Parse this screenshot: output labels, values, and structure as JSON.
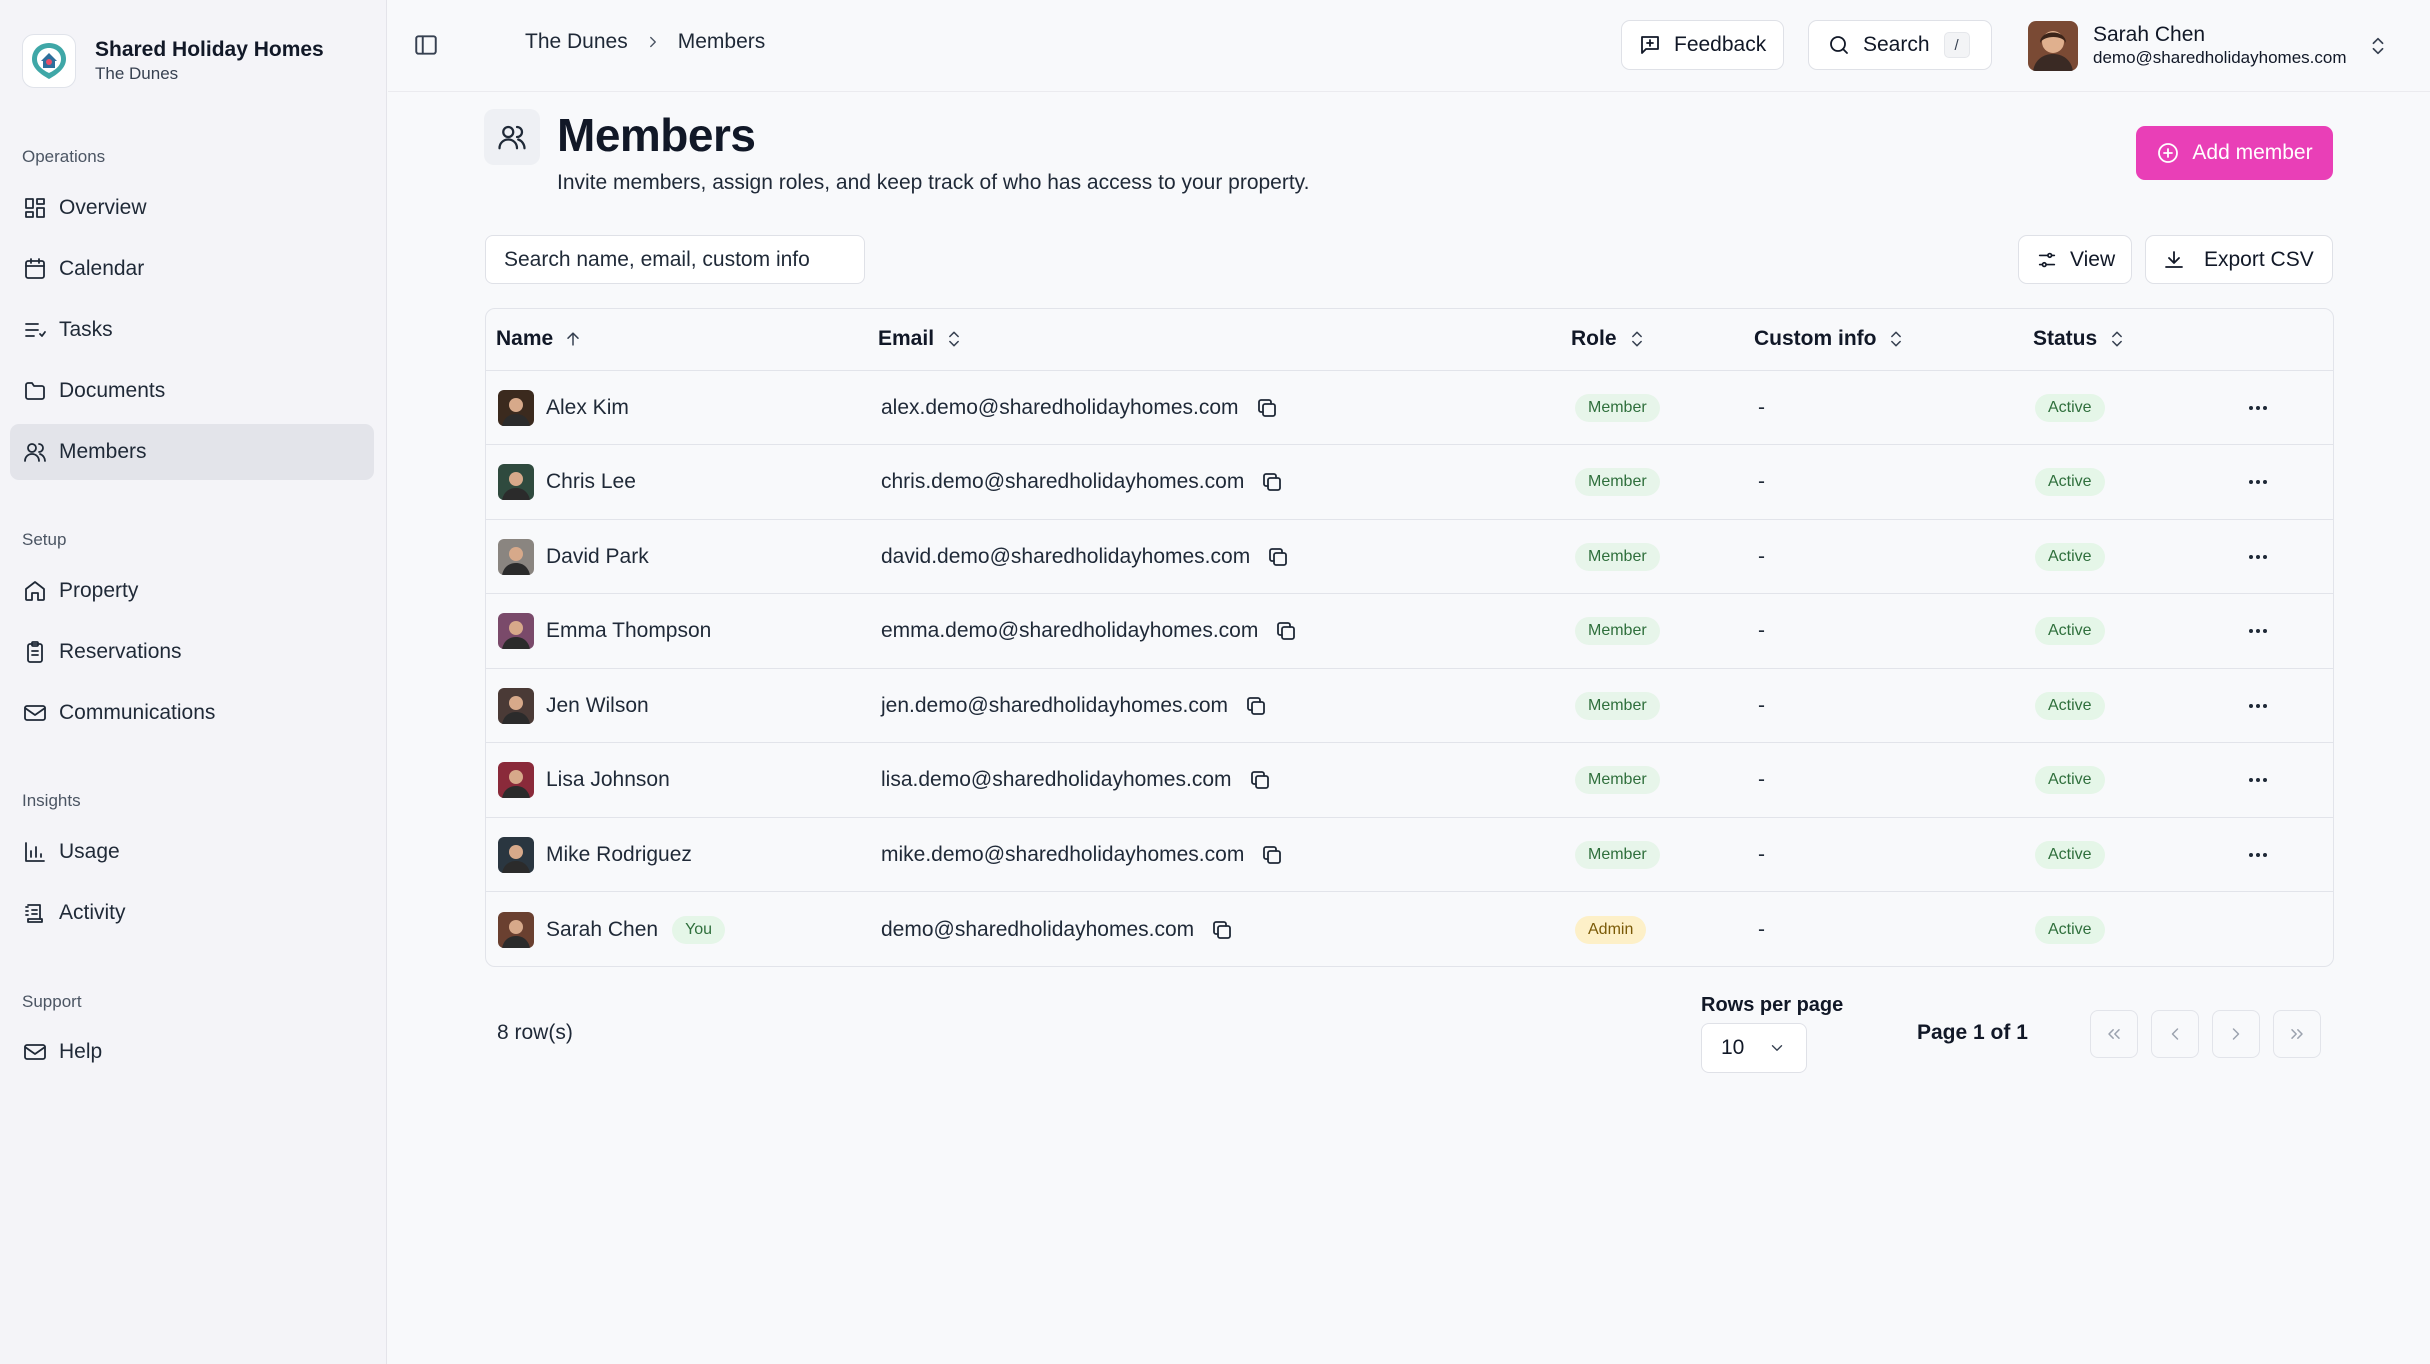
{
  "brand": {
    "name": "Shared Holiday Homes",
    "property": "The Dunes"
  },
  "sidebar": {
    "sections": [
      {
        "title": "Operations",
        "items": [
          {
            "label": "Overview",
            "icon": "grid-icon"
          },
          {
            "label": "Calendar",
            "icon": "calendar-icon"
          },
          {
            "label": "Tasks",
            "icon": "list-icon"
          },
          {
            "label": "Documents",
            "icon": "folder-icon"
          },
          {
            "label": "Members",
            "icon": "users-icon",
            "active": true
          }
        ]
      },
      {
        "title": "Setup",
        "items": [
          {
            "label": "Property",
            "icon": "home-icon"
          },
          {
            "label": "Reservations",
            "icon": "clipboard-icon"
          },
          {
            "label": "Communications",
            "icon": "mail-icon"
          }
        ]
      },
      {
        "title": "Insights",
        "items": [
          {
            "label": "Usage",
            "icon": "bar-chart-icon"
          },
          {
            "label": "Activity",
            "icon": "activity-log-icon"
          }
        ]
      },
      {
        "title": "Support",
        "items": [
          {
            "label": "Help",
            "icon": "mail-icon"
          }
        ]
      }
    ]
  },
  "topbar": {
    "breadcrumb": [
      "The Dunes",
      "Members"
    ],
    "feedback_label": "Feedback",
    "search_label": "Search",
    "search_shortcut": "/",
    "user": {
      "name": "Sarah Chen",
      "email": "demo@sharedholidayhomes.com"
    }
  },
  "page": {
    "title": "Members",
    "description": "Invite members, assign roles, and keep track of who has access to your property.",
    "add_button": "Add member",
    "search_placeholder": "Search name, email, custom info",
    "view_button": "View",
    "export_button": "Export CSV"
  },
  "table": {
    "columns": {
      "name": "Name",
      "email": "Email",
      "role": "Role",
      "custom_info": "Custom info",
      "status": "Status"
    },
    "rows": [
      {
        "name": "Alex Kim",
        "email": "alex.demo@sharedholidayhomes.com",
        "role": "Member",
        "custom_info": "-",
        "status": "Active",
        "avatar_color": "#3b2a1e"
      },
      {
        "name": "Chris Lee",
        "email": "chris.demo@sharedholidayhomes.com",
        "role": "Member",
        "custom_info": "-",
        "status": "Active",
        "avatar_color": "#2f4a3e"
      },
      {
        "name": "David Park",
        "email": "david.demo@sharedholidayhomes.com",
        "role": "Member",
        "custom_info": "-",
        "status": "Active",
        "avatar_color": "#8a8580"
      },
      {
        "name": "Emma Thompson",
        "email": "emma.demo@sharedholidayhomes.com",
        "role": "Member",
        "custom_info": "-",
        "status": "Active",
        "avatar_color": "#7a4a6a"
      },
      {
        "name": "Jen Wilson",
        "email": "jen.demo@sharedholidayhomes.com",
        "role": "Member",
        "custom_info": "-",
        "status": "Active",
        "avatar_color": "#4a3a36"
      },
      {
        "name": "Lisa Johnson",
        "email": "lisa.demo@sharedholidayhomes.com",
        "role": "Member",
        "custom_info": "-",
        "status": "Active",
        "avatar_color": "#8a2a3a"
      },
      {
        "name": "Mike Rodriguez",
        "email": "mike.demo@sharedholidayhomes.com",
        "role": "Member",
        "custom_info": "-",
        "status": "Active",
        "avatar_color": "#2a3640"
      },
      {
        "name": "Sarah Chen",
        "email": "demo@sharedholidayhomes.com",
        "role": "Admin",
        "custom_info": "-",
        "status": "Active",
        "you_label": "You",
        "avatar_color": "#6a4030"
      }
    ]
  },
  "footer": {
    "row_count": "8 row(s)",
    "rows_per_page_label": "Rows per page",
    "rows_per_page": "10",
    "page_info": "Page 1 of 1"
  },
  "colors": {
    "accent": "#e93fb7",
    "active_nav": "#e3e4ea"
  }
}
